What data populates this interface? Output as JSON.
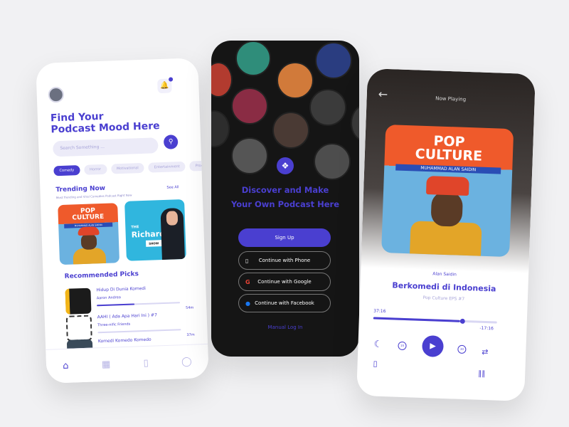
{
  "home": {
    "title_line1": "Find Your",
    "title_line2": "Podcast Mood Here",
    "search_placeholder": "Search Something ...",
    "chips": [
      "Comedy",
      "Horror",
      "Motivational",
      "Entertainment",
      "Productiv"
    ],
    "trending": {
      "title": "Trending Now",
      "subtitle": "Most Trending and Viral Comedies Podcast Right Now",
      "see_all": "See All",
      "covers": [
        {
          "title_line1": "POP",
          "title_line2": "CULTURE",
          "band": "MUHAMMAD ALAN SAIDIN"
        },
        {
          "title_line1": "THE",
          "title_line2": "Richard",
          "tag": "SHOW"
        }
      ]
    },
    "recommended": {
      "title": "Recommended Picks",
      "items": [
        {
          "title": "Hidup Di Dunia Komedi",
          "author": "Aaron Andrea",
          "duration": "54m",
          "progress": 0.45
        },
        {
          "title": "AAHI ( Ada Apa Hari Ini ) #7",
          "author": "Three-nific Friends",
          "duration": "37m",
          "progress": 0.0
        },
        {
          "title": "Komedi Komedo Komedo",
          "author": "",
          "duration": "",
          "progress": 0
        }
      ]
    },
    "nav": [
      "home-icon",
      "map-icon",
      "bookmark-icon",
      "profile-icon"
    ]
  },
  "onboard": {
    "headline_line1": "Discover and Make",
    "headline_line2": "Your Own Podcast Here",
    "sign_up": "Sign Up",
    "phone": "Continue with Phone",
    "google": "Continue with Google",
    "facebook": "Continue with Facebook",
    "manual": "Manual Log In"
  },
  "player": {
    "header": "Now Playing",
    "cover": {
      "title_line1": "POP",
      "title_line2": "CULTURE",
      "band": "MUHAMMAD ALAN SAIDIN"
    },
    "artist": "Alan Saidin",
    "title": "Berkomedi di Indonesia",
    "episode": "Pop Culture EPS #7",
    "elapsed": "37:16",
    "remaining": "-17:16",
    "progress": 0.7,
    "rewind": "15",
    "forward": "30"
  },
  "colors": {
    "accent": "#4a3fd0",
    "orange": "#ef5a2b",
    "dark": "#151515"
  }
}
